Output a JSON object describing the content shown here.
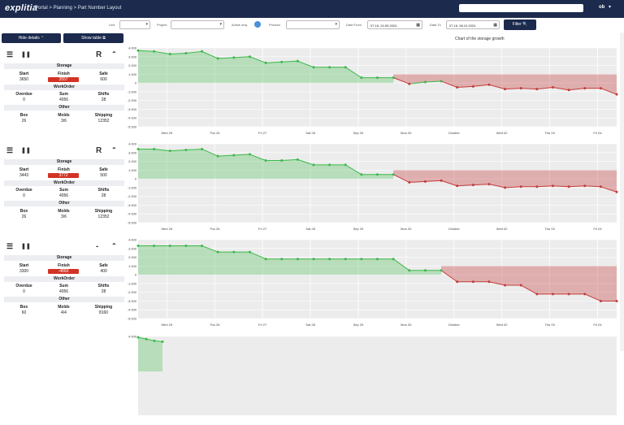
{
  "header": {
    "logo": "explitia",
    "breadcrumb": "Portal > Planning > Part Number Layout",
    "user": "ob",
    "user_caret": "▾"
  },
  "filters": {
    "line_label": "Line",
    "project_label": "Project",
    "active_only_label": "Active only",
    "product_label": "Product",
    "date_from_label": "Date From",
    "date_from": "07.16, 24.09.2024",
    "date_to_label": "Date To",
    "date_to": "07.16, 08.10.2024",
    "filter_button": "Filter 🔍",
    "caret": "▾",
    "calendar": "▦"
  },
  "toolbar": {
    "hide_details": "Hide details ⌃",
    "show_table": "Show table ⧉"
  },
  "chart_title": "Chart of the storage growth",
  "labels": {
    "storage": "Storage",
    "start": "Start",
    "finish": "Finish",
    "safe": "Safe",
    "workorder": "WorkOrder",
    "overdue": "Overdue",
    "sum": "Sum",
    "shifts": "Shifts",
    "other": "Other",
    "box": "Box",
    "molds": "Molds",
    "shipping": "Shipping"
  },
  "panels": [
    {
      "letter": "R",
      "arrow": "⌃",
      "start": "3650",
      "finish": "3557",
      "safe": "600",
      "overdue": "0",
      "sum": "4056",
      "shifts": "28",
      "box": "26",
      "molds": "3/6",
      "shipping": "12352"
    },
    {
      "letter": "R",
      "arrow": "⌃",
      "start": "3443",
      "finish": "3772",
      "safe": "500",
      "overdue": "0",
      "sum": "4056",
      "shifts": "28",
      "box": "26",
      "molds": "3/6",
      "shipping": "12352"
    },
    {
      "letter": "-",
      "arrow": "⌃",
      "start": "3300",
      "finish": "-4860",
      "safe": "400",
      "overdue": "0",
      "sum": "4056",
      "shifts": "28",
      "box": "60",
      "molds": "4/4",
      "shipping": "8160"
    }
  ],
  "icons": {
    "list": "☰",
    "pause": "❚❚"
  },
  "chart_data": [
    {
      "type": "area",
      "x": [
        "Wed 25",
        "Thu 26",
        "Fri 27",
        "Sat 28",
        "Sep 29",
        "Mon 30",
        "October",
        "Wed 02",
        "Thu 03",
        "Fri 04"
      ],
      "yticks": [
        "4.000",
        "3.000",
        "2.000",
        "1.000",
        "0",
        "-1.000",
        "-2.000",
        "-3.000",
        "-4.000",
        "-5.000"
      ],
      "ylim": [
        -5000,
        4000
      ],
      "values": [
        3700,
        3600,
        3300,
        3400,
        3600,
        2800,
        2900,
        3000,
        2300,
        2400,
        2500,
        1800,
        1800,
        1800,
        600,
        600,
        600,
        -100,
        100,
        200,
        -500,
        -400,
        -200,
        -700,
        -600,
        -700,
        -500,
        -800,
        -600,
        -600,
        -1300
      ],
      "colors": {
        "positive": "#3cb84a",
        "negative": "#c63b3b"
      }
    },
    {
      "type": "area",
      "x": [
        "Wed 25",
        "Thu 26",
        "Fri 27",
        "Sat 28",
        "Sep 29",
        "Mon 30",
        "October",
        "Wed 02",
        "Thu 03",
        "Fri 04"
      ],
      "yticks": [
        "4.000",
        "3.000",
        "2.000",
        "1.000",
        "0",
        "-1.000",
        "-2.000",
        "-3.000",
        "-4.000",
        "-5.000"
      ],
      "ylim": [
        -5000,
        4000
      ],
      "values": [
        3400,
        3400,
        3200,
        3300,
        3400,
        2600,
        2700,
        2800,
        2100,
        2100,
        2200,
        1600,
        1600,
        1600,
        500,
        500,
        500,
        -400,
        -300,
        -200,
        -800,
        -700,
        -600,
        -1000,
        -900,
        -900,
        -800,
        -900,
        -800,
        -900,
        -1500
      ],
      "colors": {
        "positive": "#3cb84a",
        "negative": "#c63b3b"
      }
    },
    {
      "type": "area",
      "x": [
        "Wed 25",
        "Thu 26",
        "Fri 27",
        "Sat 28",
        "Sep 29",
        "Mon 30",
        "October",
        "Wed 02",
        "Thu 03",
        "Fri 04"
      ],
      "yticks": [
        "4.000",
        "3.000",
        "2.000",
        "1.000",
        "0",
        "-1.000",
        "-2.000",
        "-3.000",
        "-4.000",
        "-5.000"
      ],
      "ylim": [
        -5000,
        4000
      ],
      "values": [
        3300,
        3300,
        3300,
        3300,
        3300,
        2600,
        2600,
        2600,
        1800,
        1800,
        1800,
        1800,
        1800,
        1800,
        1800,
        1800,
        1800,
        500,
        500,
        500,
        -800,
        -800,
        -800,
        -1200,
        -1200,
        -2200,
        -2200,
        -2200,
        -2200,
        -3000,
        -3000
      ],
      "colors": {
        "positive": "#3cb84a",
        "negative": "#c63b3b"
      }
    },
    {
      "type": "area",
      "x": [],
      "yticks": [
        "4.000"
      ],
      "ylim": [
        -5000,
        4000
      ],
      "values": [
        3900,
        3700,
        3500,
        3400
      ],
      "partial": true,
      "colors": {
        "positive": "#3cb84a",
        "negative": "#c63b3b"
      }
    }
  ]
}
